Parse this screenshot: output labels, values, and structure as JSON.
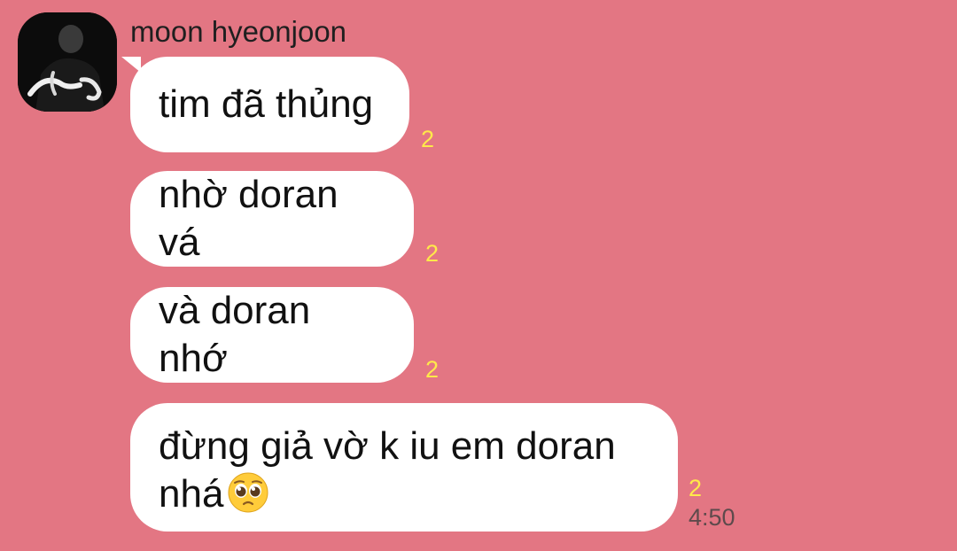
{
  "chat": {
    "sender": {
      "name": "moon hyeonjoon",
      "avatar_icon": "profile-photo-avatar"
    },
    "messages": [
      {
        "text": "tim đã thủng",
        "unread": "2"
      },
      {
        "text": "nhờ doran vá",
        "unread": "2"
      },
      {
        "text": "và doran nhớ",
        "unread": "2"
      },
      {
        "line1": "đừng giả vờ k iu em doran",
        "line2": "nhá",
        "emoji": "pleading-face-emoji",
        "unread": "2",
        "time": "4:50"
      }
    ]
  },
  "colors": {
    "background": "#e37683",
    "bubble": "#ffffff",
    "unread_count": "#ffe94a"
  }
}
